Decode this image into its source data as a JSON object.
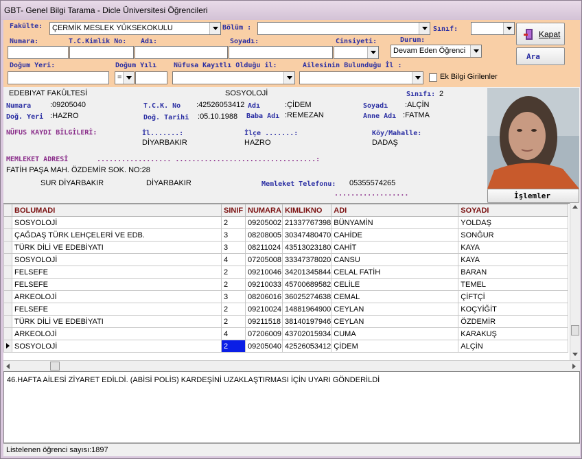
{
  "window": {
    "title": "GBT- Genel Bilgi Tarama - Dicle Üniversitesi Öğrencileri"
  },
  "filters": {
    "fakulte_label": "Fakülte:",
    "fakulte_value": "ÇERMİK  MESLEK YÜKSEKOKULU",
    "bolum_label": "Bölüm :",
    "bolum_value": "",
    "sinif_label": "Sınıf:",
    "sinif_value": "",
    "numara_label": "Numara:",
    "tc_label": "T.C.Kimlik No:",
    "adi_label": "Adı:",
    "soyadi_label": "Soyadı:",
    "cinsiyet_label": "Cinsiyeti:",
    "durum_label": "Durum:",
    "durum_value": "Devam Eden Öğrenci",
    "dogum_yeri_label": "Doğum Yeri:",
    "dogum_yili_label": "Doğum Yılı",
    "dogum_yili_op": "=",
    "nufus_label": "Nüfusa Kayıtlı Olduğu il:",
    "aile_label": "Ailesinin Bulunduğu İl :",
    "ek_bilgi_label": "Ek Bilgi Girilenler"
  },
  "buttons": {
    "kapat": "Kapat",
    "ara": "Ara",
    "islemler": "İşlemler"
  },
  "student": {
    "fakulte": "EDEBIYAT FAKÜLTESİ",
    "bolum": "SOSYOLOJİ",
    "sinif_label": "Sınıfı:",
    "sinif": "2",
    "numara_label": "Numara",
    "numara": "09205040",
    "tck_label": "T.C.K. No",
    "tck": "42526053412",
    "adi_label": "Adı",
    "adi": "ÇİDEM",
    "soyadi_label": "Soyadı",
    "soyadi": "ALÇİN",
    "dog_yeri_label": "Doğ. Yeri",
    "dog_yeri": "HAZRO",
    "dog_tarihi_label": "Doğ. Tarihi",
    "dog_tarihi": "05.10.1988",
    "baba_label": "Baba Adı",
    "baba": "REMEZAN",
    "anne_label": "Anne Adı",
    "anne": "FATMA",
    "nufus_title": "NÜFUS KAYDI BİLGİLERİ:",
    "il_label": "İl.......:",
    "il": "DİYARBAKIR",
    "ilce_label": "İlçe .......:",
    "ilce": "HAZRO",
    "koy_label": "Köy/Mahalle:",
    "koy": "DADAŞ",
    "memleket_title": "MEMLEKET ADRESİ",
    "memleket_dots": ".................. ..................................:",
    "adres1": "FATİH PAŞA MAH. ÖZDEMİR SOK. NO:28",
    "adres_ilce": "SUR DİYARBAKIR",
    "adres_il": "DİYARBAKIR",
    "tel_label": "Memleket Telefonu:",
    "tel": "05355574265",
    "tel_dots": ".................."
  },
  "table": {
    "columns": [
      "BOLUMADI",
      "SINIF",
      "NUMARA",
      "KIMLIKNO",
      "ADI",
      "SOYADI"
    ],
    "rows": [
      [
        "SOSYOLOJİ",
        "2",
        "09205002",
        "21337767398",
        "BÜNYAMİN",
        "YOLDAŞ"
      ],
      [
        "ÇAĞDAŞ TÜRK LEHÇELERİ VE EDB.",
        "3",
        "08208005",
        "30347480470",
        "CAHİDE",
        "SONĞUR"
      ],
      [
        "TÜRK DİLİ VE EDEBİYATI",
        "3",
        "08211024",
        "43513023180",
        "CAHİT",
        "KAYA"
      ],
      [
        "SOSYOLOJİ",
        "4",
        "07205008",
        "33347378020",
        "CANSU",
        "KAYA"
      ],
      [
        "FELSEFE",
        "2",
        "09210046",
        "34201345844",
        "CELAL FATİH",
        "BARAN"
      ],
      [
        "FELSEFE",
        "2",
        "09210033",
        "45700689582",
        "CELİLE",
        "TEMEL"
      ],
      [
        "ARKEOLOJİ",
        "3",
        "08206016",
        "36025274638",
        "CEMAL",
        "ÇİFTÇİ"
      ],
      [
        "FELSEFE",
        "2",
        "09210024",
        "14881964900",
        "CEYLAN",
        "KOÇYİĞİT"
      ],
      [
        "TÜRK DİLİ VE EDEBİYATI",
        "2",
        "09211518",
        "38140197946",
        "CEYLAN",
        "ÖZDEMİR"
      ],
      [
        "ARKEOLOJİ",
        "4",
        "07206009",
        "43702015934",
        "CUMA",
        "KARAKUŞ"
      ],
      [
        "SOSYOLOJİ",
        "2",
        "09205040",
        "42526053412",
        "ÇİDEM",
        "ALÇİN"
      ]
    ]
  },
  "notes": "46.HAFTA AİLESİ ZİYARET EDİLDİ. (ABİSİ POLİS) KARDEŞİNİ UZAKLAŞTIRMASI İÇİN UYARI GÖNDERİLDİ",
  "status": "Listelenen öğrenci sayısı:1897"
}
